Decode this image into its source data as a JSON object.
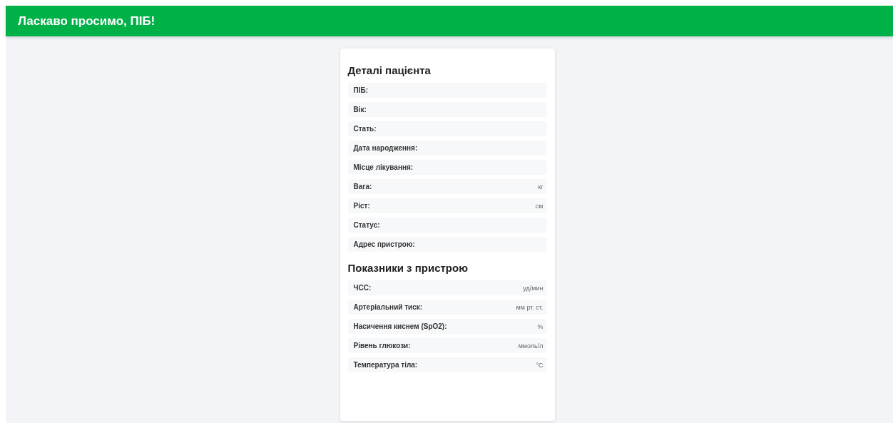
{
  "header": {
    "title": "Ласкаво просимо, ПІБ!"
  },
  "sections": [
    {
      "title": "Деталі пацієнта",
      "rows": [
        {
          "label": "ПІБ:"
        },
        {
          "label": "Вік:"
        },
        {
          "label": "Стать:"
        },
        {
          "label": "Дата народження:"
        },
        {
          "label": "Місце лікування:"
        },
        {
          "label": "Вага:",
          "unit": "кг"
        },
        {
          "label": "Ріст:",
          "unit": "см"
        },
        {
          "label": "Статус:"
        },
        {
          "label": "Адрес пристрою:"
        }
      ]
    },
    {
      "title": "Показники з пристрою",
      "rows": [
        {
          "label": "ЧСС:",
          "unit": "уд/мин"
        },
        {
          "label": "Артеріальний тиск:",
          "unit": "мм рт. ст."
        },
        {
          "label": "Насичення киснем (SpO2):",
          "unit": "%"
        },
        {
          "label": "Рівень глюкози:",
          "unit": "ммоль/л"
        },
        {
          "label": "Температура тіла:",
          "unit": "°C"
        }
      ]
    }
  ]
}
